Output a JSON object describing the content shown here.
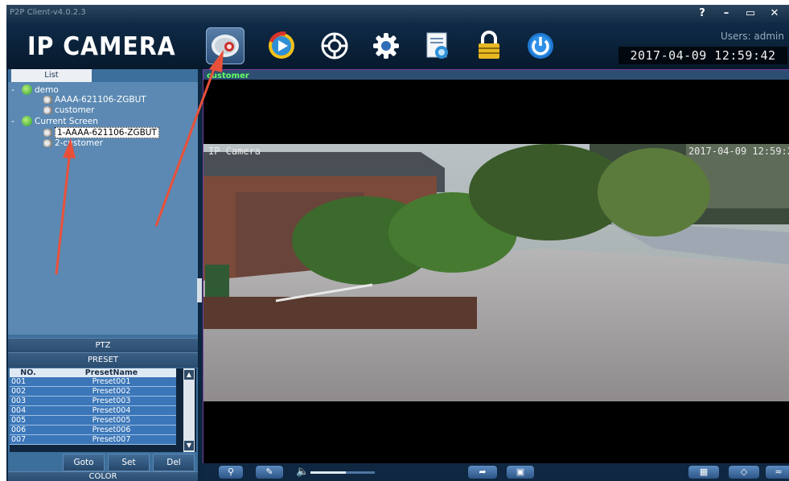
{
  "window": {
    "title": "P2P Client-v4.0.2.3",
    "help": "?",
    "minimize": "–",
    "maximize": "▭",
    "close": "✕"
  },
  "header": {
    "logo": "IP CAMERA",
    "users": "Users: admin",
    "datetime": "2017-04-09  12:59:42"
  },
  "toolbar": {
    "icons": [
      "camera-icon",
      "playback-icon",
      "ptz-wheel-icon",
      "settings-icon",
      "log-icon",
      "lock-icon",
      "power-icon"
    ],
    "active": "camera-icon"
  },
  "left": {
    "tab": "List",
    "tree": {
      "demo": {
        "label": "demo",
        "children": [
          "AAAA-621106-ZGBUT",
          "customer"
        ]
      },
      "current": {
        "label": "Current Screen",
        "children": [
          "1-AAAA-621106-ZGBUT",
          "2-customer"
        ]
      }
    },
    "ptz": "PTZ",
    "preset": "PRESET",
    "color": "COLOR",
    "preset_table": {
      "headers": [
        "NO.",
        "PresetName"
      ],
      "rows": [
        [
          "001",
          "Preset001"
        ],
        [
          "002",
          "Preset002"
        ],
        [
          "003",
          "Preset003"
        ],
        [
          "004",
          "Preset004"
        ],
        [
          "005",
          "Preset005"
        ],
        [
          "006",
          "Preset006"
        ],
        [
          "007",
          "Preset007"
        ]
      ]
    },
    "buttons": {
      "goto": "Goto",
      "set": "Set",
      "del": "Del"
    }
  },
  "video": {
    "channel_label": "customer",
    "osd_left": "IP Camera",
    "osd_right": "2017-04-09 12:59:2",
    "volume_level": 0.55
  },
  "colors": {
    "panel": "#3d6f9c",
    "tree": "#5b89b3",
    "annotation_arrow": "#e8503a",
    "header": "#0f2b48"
  }
}
